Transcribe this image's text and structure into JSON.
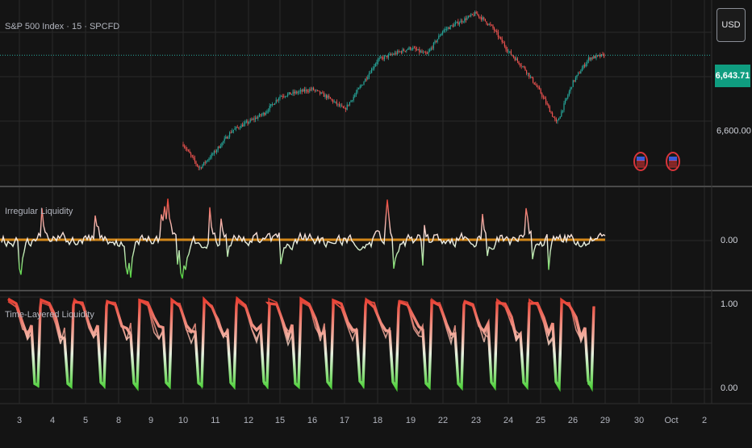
{
  "header": {
    "symbol_title": "S&P 500 Index · 15 · SPCFD",
    "currency_label": "USD"
  },
  "price_scale": {
    "last_price": "6,643.71",
    "tick_label": "6,600.00"
  },
  "pane2": {
    "title": "Irregular Liquidity",
    "zero_label": "0.00"
  },
  "pane3": {
    "title": "Time-Layered Liquidity",
    "top_label": "1.00",
    "bottom_label": "0.00"
  },
  "colors": {
    "background": "#141414",
    "grid": "#2a2a2a",
    "up": "#26a69a",
    "down": "#ef5350",
    "orange_line": "#e8941a",
    "low_liquidity": "#4cd137",
    "high_liquidity": "#e8392c",
    "price_badge": "#0f9d80"
  },
  "icons": [
    "us-flag-event-icon",
    "us-flag-event-icon"
  ],
  "chart_data": [
    {
      "type": "candlestick",
      "title": "S&P 500 Index · 15 · SPCFD",
      "x_tick_labels": [
        "3",
        "4",
        "5",
        "8",
        "9",
        "10",
        "11",
        "12",
        "15",
        "16",
        "17",
        "18",
        "19",
        "22",
        "23",
        "24",
        "25",
        "26",
        "29",
        "30",
        "Oct",
        "2"
      ],
      "close_path": [
        {
          "x": "10",
          "y": 6592
        },
        {
          "x": "10.5",
          "y": 6578
        },
        {
          "x": "11",
          "y": 6588
        },
        {
          "x": "11.5",
          "y": 6600
        },
        {
          "x": "12",
          "y": 6605
        },
        {
          "x": "12.5",
          "y": 6610
        },
        {
          "x": "15",
          "y": 6620
        },
        {
          "x": "16",
          "y": 6624
        },
        {
          "x": "16.5",
          "y": 6619
        },
        {
          "x": "17",
          "y": 6612
        },
        {
          "x": "17.5",
          "y": 6626
        },
        {
          "x": "18",
          "y": 6641
        },
        {
          "x": "19",
          "y": 6648
        },
        {
          "x": "19.5",
          "y": 6644
        },
        {
          "x": "22",
          "y": 6658
        },
        {
          "x": "23",
          "y": 6668
        },
        {
          "x": "23.5",
          "y": 6660
        },
        {
          "x": "24",
          "y": 6646
        },
        {
          "x": "24.5",
          "y": 6636
        },
        {
          "x": "25",
          "y": 6622
        },
        {
          "x": "25.5",
          "y": 6604
        },
        {
          "x": "26",
          "y": 6628
        },
        {
          "x": "26.5",
          "y": 6642
        },
        {
          "x": "29",
          "y": 6643.71
        }
      ],
      "last_price": 6643.71,
      "ylim": [
        6568,
        6672
      ]
    },
    {
      "type": "line",
      "title": "Irregular Liquidity",
      "reference_line": 0,
      "note_series": "oscillator around 0.00 with red peaks above and green troughs below"
    },
    {
      "type": "line",
      "title": "Time-Layered Liquidity",
      "ylim": [
        0,
        1
      ],
      "pattern": "daily cycles between 0.00 (green) and 1.00 (red)"
    }
  ]
}
